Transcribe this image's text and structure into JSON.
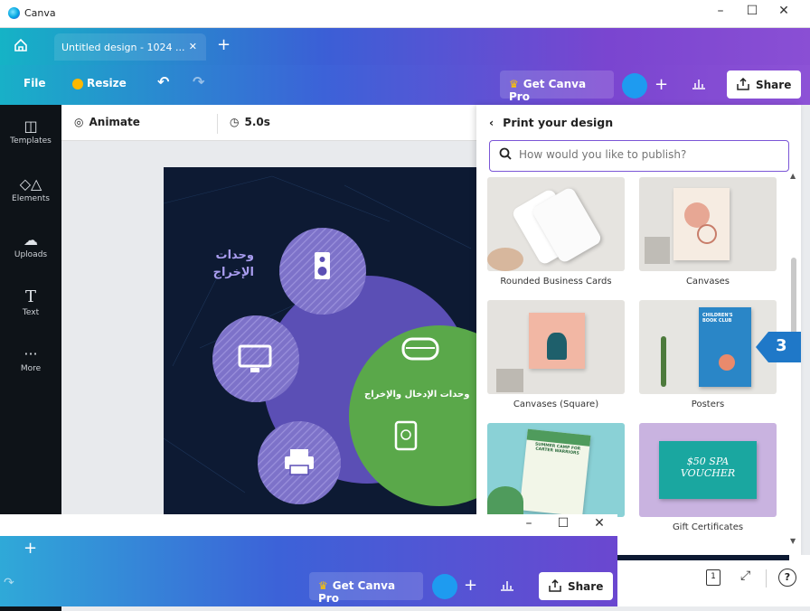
{
  "window": {
    "title": "Canva",
    "minimize": "–",
    "maximize": "☐",
    "close": "✕"
  },
  "tabs": {
    "home_icon": "home-icon",
    "active_tab": "Untitled design - 1024 ...",
    "close": "✕",
    "new_tab": "+"
  },
  "toolbar": {
    "file": "File",
    "resize": "Resize",
    "undo": "↶",
    "redo": "↷",
    "get_pro": "Get Canva Pro",
    "plus": "+",
    "share": "Share"
  },
  "sidebar": {
    "items": [
      {
        "label": "Templates",
        "icon": "templates-icon"
      },
      {
        "label": "Elements",
        "icon": "elements-icon"
      },
      {
        "label": "Uploads",
        "icon": "uploads-icon"
      },
      {
        "label": "Text",
        "icon": "text-icon"
      },
      {
        "label": "More",
        "icon": "more-icon"
      }
    ]
  },
  "subtoolbar": {
    "animate": "Animate",
    "duration": "5.0s"
  },
  "design": {
    "label_output": "وحدات الإخراج",
    "label_io": "وحدات الإدخال والإخراج"
  },
  "panel": {
    "title": "Print your design",
    "search_placeholder": "How would you like to publish?",
    "items": [
      {
        "label": "Rounded Business Cards"
      },
      {
        "label": "Canvases"
      },
      {
        "label": "Canvases (Square)"
      },
      {
        "label": "Posters"
      },
      {
        "label": ""
      },
      {
        "label": "Gift Certificates"
      }
    ],
    "poster_text": "CHILDREN'S BOOK CLUB",
    "voucher_text": "$50 SPA VOUCHER",
    "flyer_text": "SUMMER CAMP FOR CARTER WARRIORS"
  },
  "badge": {
    "number": "3",
    "color": "#1f78c8"
  },
  "overlay": {
    "minimize": "–",
    "maximize": "☐",
    "close": "✕",
    "new_tab": "+",
    "get_pro": "Get Canva Pro",
    "plus": "+",
    "share": "Share"
  },
  "bottom": {
    "help": "?"
  },
  "colors": {
    "accent": "#7b56d6",
    "sidebar_bg": "#0e1318",
    "design_bg": "#0d1a33",
    "purple_circle": "#5b4fb5",
    "green_circle": "#5aa84a"
  }
}
